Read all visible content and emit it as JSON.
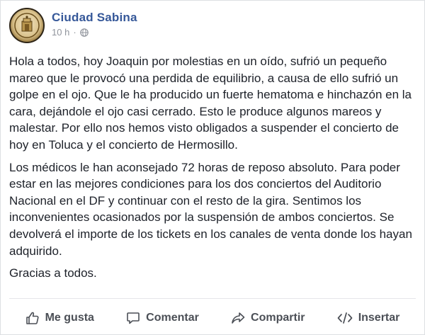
{
  "post": {
    "page_name": "Ciudad Sabina",
    "timestamp": "10 h",
    "separator": "·",
    "privacy_icon": "globe-icon",
    "paragraphs": [
      "Hola a todos, hoy Joaquin por molestias en un oído, sufrió un pequeño mareo que le provocó una perdida de equilibrio, a causa de ello sufrió un golpe en el ojo. Que le ha producido un fuerte hematoma e hinchazón en la cara, dejándole el ojo casi cerrado. Esto le produce algunos mareos y malestar. Por ello nos hemos visto obligados a suspender el concierto de hoy en Toluca y el concierto de Hermosillo.",
      "Los médicos le han aconsejado 72 horas de reposo absoluto. Para poder estar en las mejores condiciones para los dos conciertos del Auditorio Nacional en el DF y continuar con el resto de la gira. Sentimos los inconvenientes ocasionados por la suspensión de ambos conciertos. Se devolverá el importe de los tickets en los canales de venta donde los hayan adquirido.",
      "Gracias a todos."
    ]
  },
  "actions": {
    "like": {
      "label": "Me gusta",
      "icon": "thumbs-up-icon"
    },
    "comment": {
      "label": "Comentar",
      "icon": "comment-bubble-icon"
    },
    "share": {
      "label": "Compartir",
      "icon": "share-arrow-icon"
    },
    "embed": {
      "label": "Insertar",
      "icon": "code-brackets-icon"
    }
  },
  "colors": {
    "page_name": "#365899",
    "text": "#1d2129",
    "meta": "#90949c",
    "action": "#4b4f56"
  }
}
